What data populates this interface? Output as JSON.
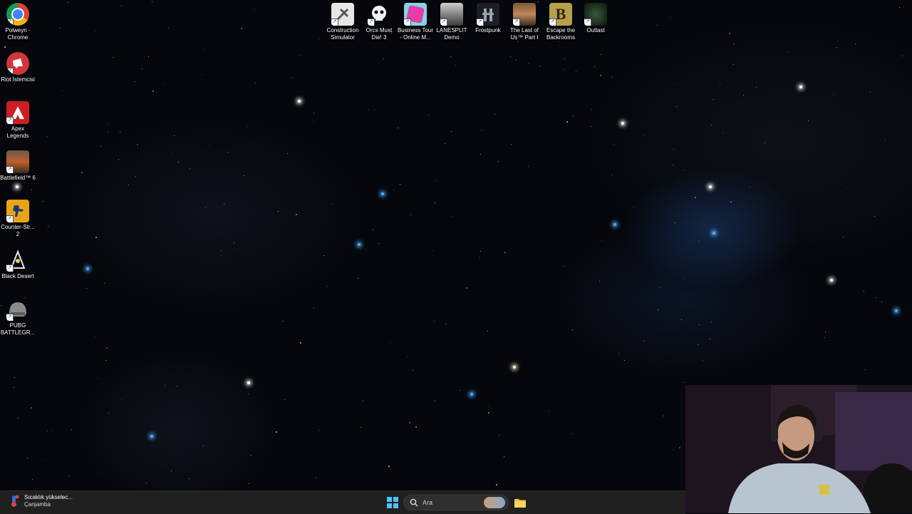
{
  "desktop_icons_left": [
    {
      "label": "Polweyn -\nChrome",
      "icon": "chrome-icon"
    },
    {
      "label": "Riot İstemcisi",
      "icon": "riot-client-icon"
    },
    {
      "label": "Apex\nLegends",
      "icon": "apex-legends-icon"
    },
    {
      "label": "Battlefield™ 6",
      "icon": "battlefield-icon"
    },
    {
      "label": "Counter-Str...\n2",
      "icon": "counter-strike-icon"
    },
    {
      "label": "Black Desert",
      "icon": "black-desert-icon"
    },
    {
      "label": "PUBG\nBATTLEGR...",
      "icon": "pubg-icon"
    }
  ],
  "desktop_icons_top": [
    {
      "label": "Construction\nSimulator",
      "icon": "construction-simulator-icon"
    },
    {
      "label": "Orcs Must\nDie! 3",
      "icon": "orcs-must-die-icon"
    },
    {
      "label": "Business Tour\n- Online M...",
      "icon": "business-tour-icon"
    },
    {
      "label": "LANESPLIT\nDemo",
      "icon": "lanesplit-icon"
    },
    {
      "label": "Frostpunk",
      "icon": "frostpunk-icon"
    },
    {
      "label": "The Last of\nUs™ Part I",
      "icon": "last-of-us-icon"
    },
    {
      "label": "Escape the\nBackrooms",
      "icon": "escape-backrooms-icon"
    },
    {
      "label": "Outlast",
      "icon": "outlast-icon"
    }
  ],
  "taskbar": {
    "weather_title": "Sıcaklık yükselec...",
    "weather_sub": "Çarşamba",
    "search_placeholder": "Ara"
  },
  "colors": {
    "taskbar_bg": "#202020",
    "start_accent": "#4cc2ff"
  }
}
